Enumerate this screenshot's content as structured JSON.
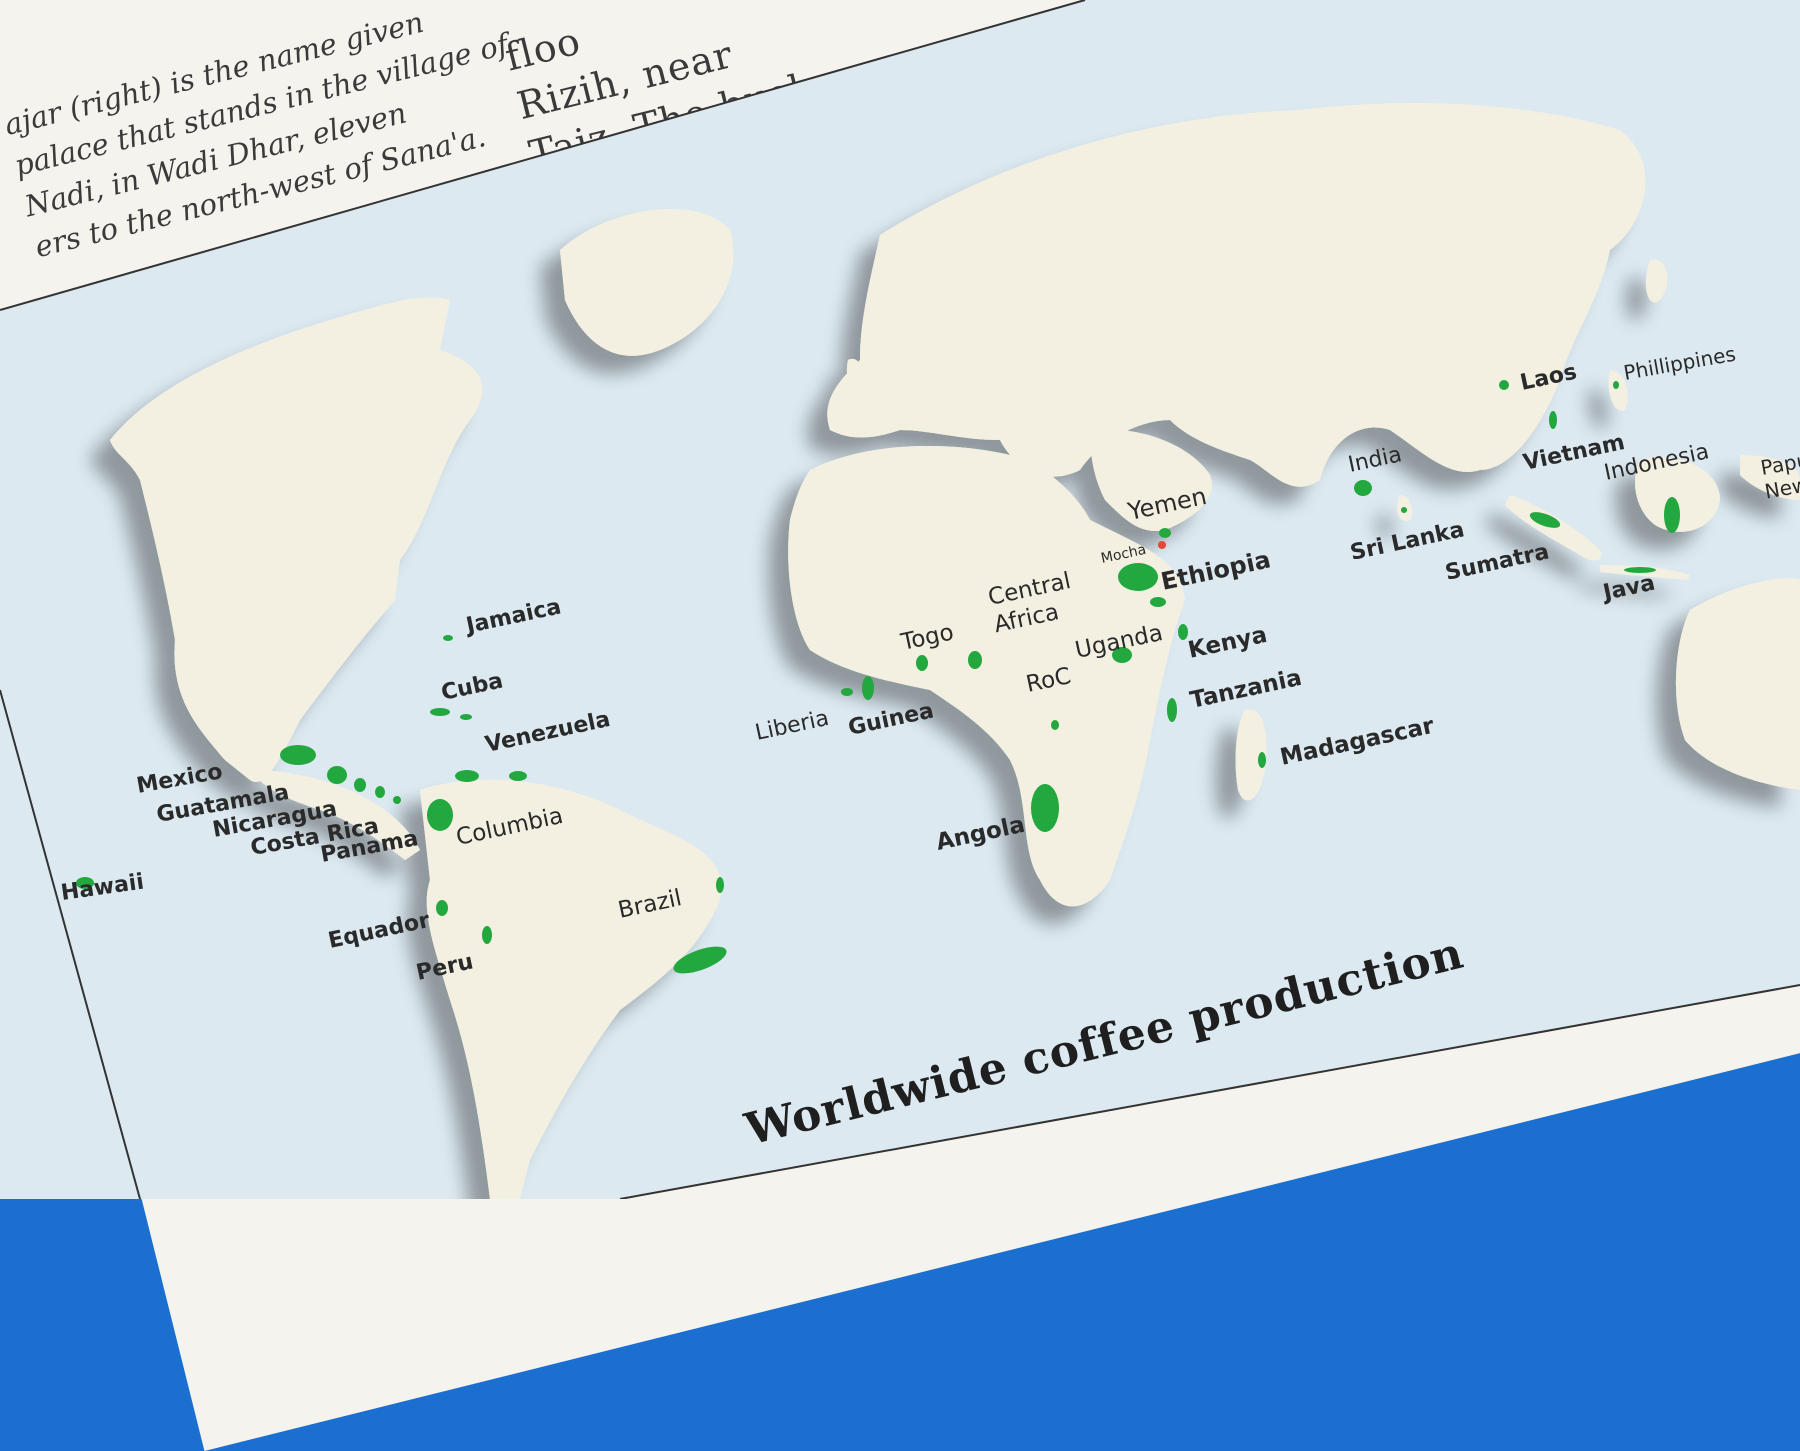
{
  "page_text": {
    "left_lines": [
      "ajar (right) is the name given",
      "palace that stands in the village of",
      "Nadi, in Wadi Dhar, eleven",
      "ers to the north-west of Sana'a."
    ],
    "right_lines": [
      "floo",
      "Rizih, near",
      "Taiz. The bushes"
    ]
  },
  "map": {
    "title": "Worldwide coffee production",
    "colors": {
      "ocean": "#dce9f1",
      "land": "#f3f0e2",
      "coffee_region": "#22a83e",
      "yemen_label": "#3b3a6e",
      "mocha_marker": "#e5473a"
    },
    "regions": [
      {
        "id": "hawaii",
        "label": "Hawaii"
      },
      {
        "id": "mexico",
        "label": "Mexico"
      },
      {
        "id": "guatamala",
        "label": "Guatamala"
      },
      {
        "id": "nicaragua",
        "label": "Nicaragua"
      },
      {
        "id": "costa-rica",
        "label": "Costa Rica"
      },
      {
        "id": "panama",
        "label": "Panama"
      },
      {
        "id": "jamaica",
        "label": "Jamaica"
      },
      {
        "id": "cuba",
        "label": "Cuba"
      },
      {
        "id": "venezuela",
        "label": "Venezuela"
      },
      {
        "id": "columbia",
        "label": "Columbia"
      },
      {
        "id": "equador",
        "label": "Equador"
      },
      {
        "id": "peru",
        "label": "Peru"
      },
      {
        "id": "brazil",
        "label": "Brazil"
      },
      {
        "id": "liberia",
        "label": "Liberia"
      },
      {
        "id": "guinea",
        "label": "Guinea"
      },
      {
        "id": "togo",
        "label": "Togo"
      },
      {
        "id": "central-africa",
        "label": "Central\nAfrica"
      },
      {
        "id": "roc",
        "label": "RoC"
      },
      {
        "id": "angola",
        "label": "Angola"
      },
      {
        "id": "uganda",
        "label": "Uganda"
      },
      {
        "id": "kenya",
        "label": "Kenya"
      },
      {
        "id": "tanzania",
        "label": "Tanzania"
      },
      {
        "id": "madagascar",
        "label": "Madagascar"
      },
      {
        "id": "ethiopia",
        "label": "Ethiopia"
      },
      {
        "id": "yemen",
        "label": "Yemen"
      },
      {
        "id": "mocha",
        "label": "Mocha"
      },
      {
        "id": "india",
        "label": "India"
      },
      {
        "id": "sri-lanka",
        "label": "Sri Lanka"
      },
      {
        "id": "sumatra",
        "label": "Sumatra"
      },
      {
        "id": "java",
        "label": "Java"
      },
      {
        "id": "laos",
        "label": "Laos"
      },
      {
        "id": "vietnam",
        "label": "Vietnam"
      },
      {
        "id": "indonesia",
        "label": "Indonesia"
      },
      {
        "id": "phillippines",
        "label": "Phillippines"
      },
      {
        "id": "papua-new-guinea",
        "label": "Papua\nNew"
      }
    ]
  }
}
